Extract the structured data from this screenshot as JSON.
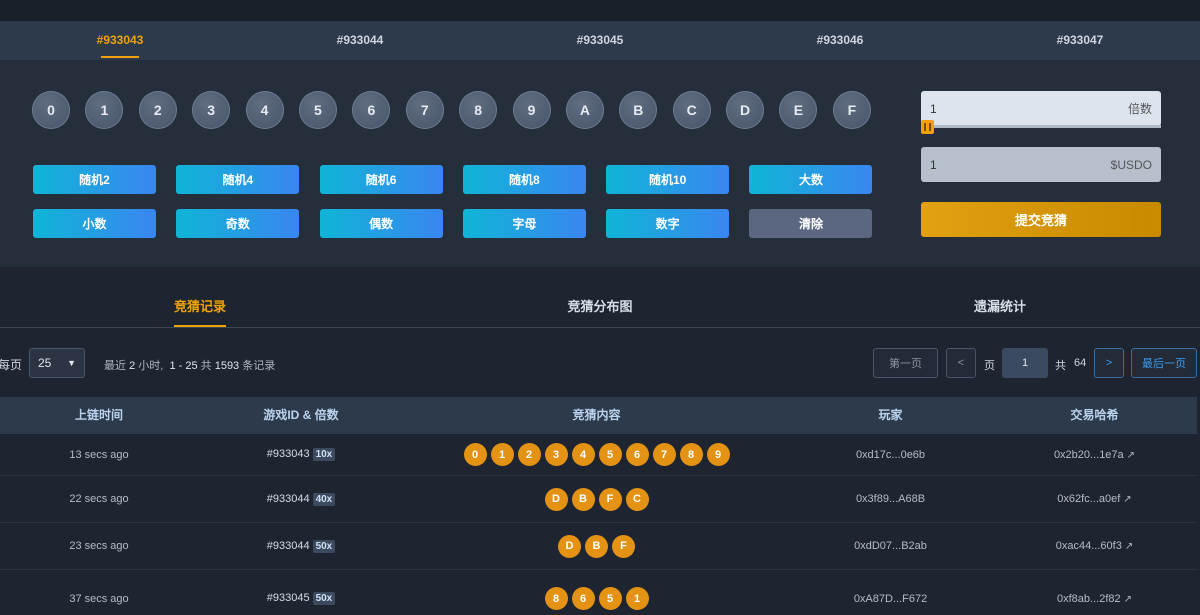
{
  "game_tabs": [
    {
      "label": "#933043",
      "active": true
    },
    {
      "label": "#933044",
      "active": false
    },
    {
      "label": "#933045",
      "active": false
    },
    {
      "label": "#933046",
      "active": false
    },
    {
      "label": "#933047",
      "active": false
    }
  ],
  "digits": [
    "0",
    "1",
    "2",
    "3",
    "4",
    "5",
    "6",
    "7",
    "8",
    "9",
    "A",
    "B",
    "C",
    "D",
    "E",
    "F"
  ],
  "quick_buttons": [
    "随机2",
    "随机4",
    "随机6",
    "随机8",
    "随机10",
    "大数",
    "小数",
    "奇数",
    "偶数",
    "字母",
    "数字",
    "清除"
  ],
  "multiplier_field": {
    "value": "1",
    "suffix": "倍数"
  },
  "amount_field": {
    "value": "1",
    "suffix": "$USDO"
  },
  "submit_label": "提交竞猜",
  "record_tabs": [
    {
      "label": "竞猜记录",
      "active": true
    },
    {
      "label": "竞猜分布图",
      "active": false
    },
    {
      "label": "遗漏统计",
      "active": false
    }
  ],
  "pager": {
    "per_page_label": "每页",
    "per_page_value": "25",
    "range_prefix": "最近",
    "range_hours": "2",
    "range_mid": "小时,",
    "range_from_to": "1 - 25",
    "range_total_label": "共",
    "range_total": "1593",
    "range_suffix": "条记录",
    "first_label": "第一页",
    "prev_label": "<",
    "page_label": "页",
    "current_page": "1",
    "total_label": "共",
    "total_pages": "64",
    "next_label": ">",
    "last_label": "最后一页"
  },
  "table": {
    "headers": [
      "上链时间",
      "游戏ID & 倍数",
      "竞猜内容",
      "玩家",
      "交易哈希"
    ],
    "rows": [
      {
        "time": "13 secs ago",
        "game_id": "#933043",
        "mult": "10x",
        "balls": [
          "0",
          "1",
          "2",
          "3",
          "4",
          "5",
          "6",
          "7",
          "8",
          "9"
        ],
        "player": "0xd17c...0e6b",
        "hash": "0x2b20...1e7a"
      },
      {
        "time": "22 secs ago",
        "game_id": "#933044",
        "mult": "40x",
        "balls": [
          "D",
          "B",
          "F",
          "C"
        ],
        "player": "0x3f89...A68B",
        "hash": "0x62fc...a0ef"
      },
      {
        "time": "23 secs ago",
        "game_id": "#933044",
        "mult": "50x",
        "balls": [
          "D",
          "B",
          "F"
        ],
        "player": "0xdD07...B2ab",
        "hash": "0xac44...60f3"
      },
      {
        "time": "37 secs ago",
        "game_id": "#933045",
        "mult": "50x",
        "balls": [
          "8",
          "6",
          "5",
          "1"
        ],
        "player": "0xA87D...F672",
        "hash": "0xf8ab...2f82"
      }
    ]
  },
  "icons": {
    "external_link": "external-link-icon",
    "chevron": "chevron-down-icon",
    "slider": "slider-handle-icon"
  }
}
